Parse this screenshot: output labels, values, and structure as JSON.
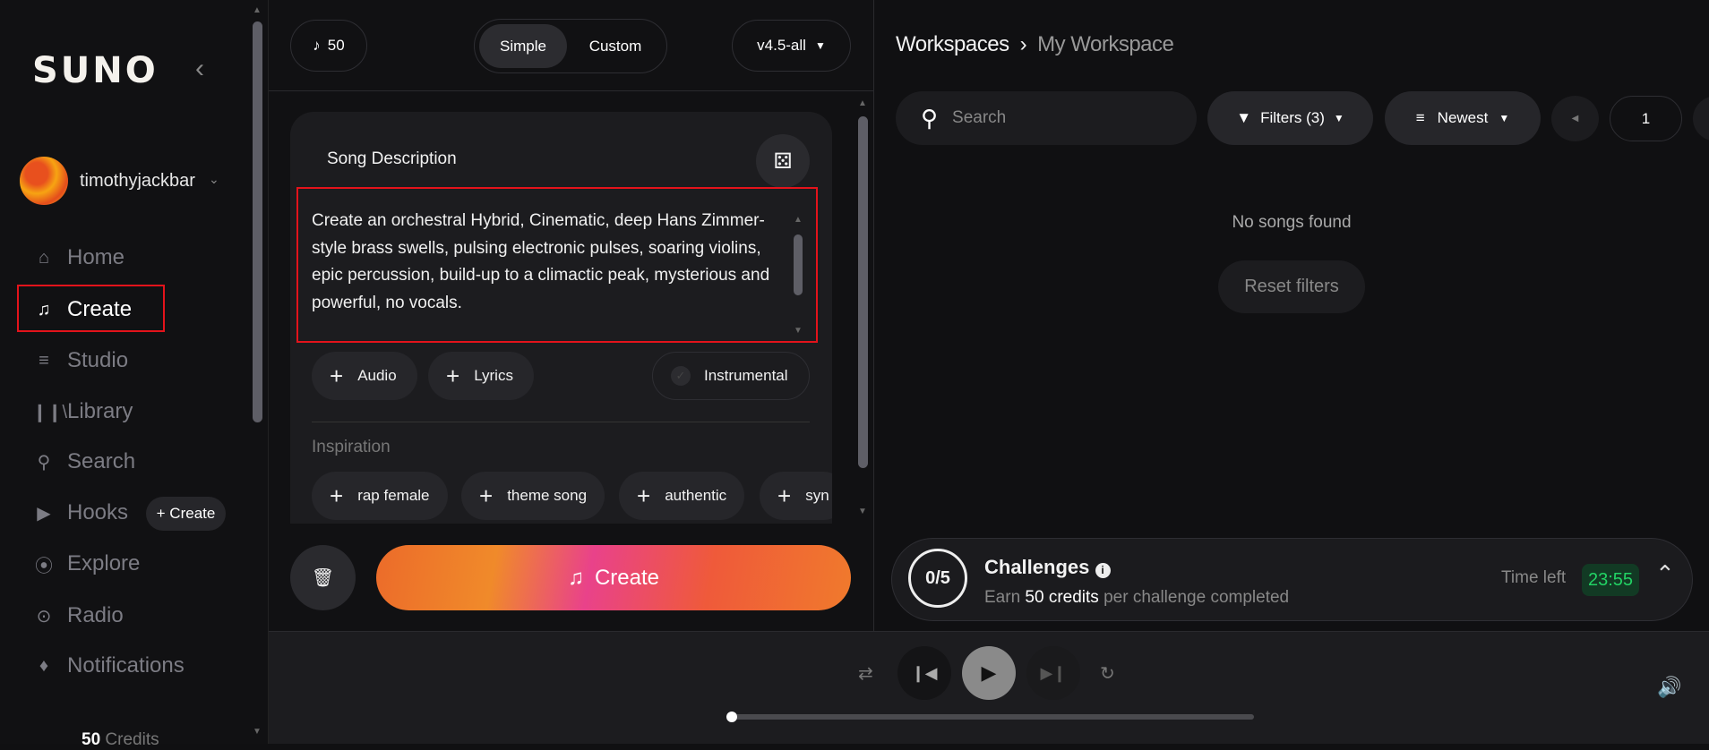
{
  "sidebar": {
    "logo": "SUNO",
    "username": "timothyjackbar",
    "nav": [
      {
        "label": "Home",
        "icon": "home-icon"
      },
      {
        "label": "Create",
        "icon": "music-sparkle-icon"
      },
      {
        "label": "Studio",
        "icon": "studio-icon"
      },
      {
        "label": "Library",
        "icon": "library-icon"
      },
      {
        "label": "Search",
        "icon": "search-icon"
      },
      {
        "label": "Hooks",
        "icon": "hooks-icon"
      },
      {
        "label": "Explore",
        "icon": "compass-icon"
      },
      {
        "label": "Radio",
        "icon": "radio-icon"
      },
      {
        "label": "Notifications",
        "icon": "bell-icon"
      }
    ],
    "hooks_create": "+ Create",
    "credits_value": "50",
    "credits_label": "Credits"
  },
  "create": {
    "credits": "50",
    "mode_simple": "Simple",
    "mode_custom": "Custom",
    "model": "v4.5-all",
    "song_description_label": "Song Description",
    "description": "Create an orchestral Hybrid, Cinematic, deep Hans Zimmer-style brass swells, pulsing electronic pulses, soaring violins, epic percussion, build-up to a climactic peak, mysterious and powerful, no vocals.",
    "audio": "Audio",
    "lyrics": "Lyrics",
    "instrumental": "Instrumental",
    "inspiration_label": "Inspiration",
    "inspiration": [
      "rap female",
      "theme song",
      "authentic",
      "syn"
    ],
    "create_button": "Create"
  },
  "workspace": {
    "breadcrumb_root": "Workspaces",
    "breadcrumb_current": "My Workspace",
    "search_placeholder": "Search",
    "filters": "Filters (3)",
    "sort": "Newest",
    "page": "1",
    "empty": "No songs found",
    "reset": "Reset filters"
  },
  "challenges": {
    "progress": "0/5",
    "title": "Challenges",
    "earn": "Earn",
    "credits": "50 credits",
    "suffix": "per challenge completed",
    "time_left_label": "Time left",
    "time_left": "23:55"
  },
  "player": {
    "progress": 0
  },
  "colors": {
    "accent_red": "#e3131b",
    "timer_green": "#22d364"
  }
}
